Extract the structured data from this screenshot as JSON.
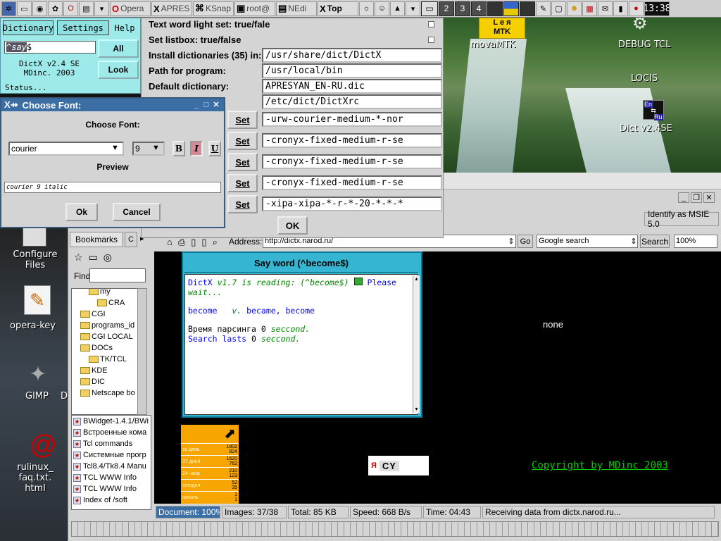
{
  "taskbar": {
    "tasks": [
      "Opera",
      "APRES",
      "KSnap",
      "root@",
      "NEdi",
      "Top"
    ],
    "desktops": [
      "2",
      "3",
      "4"
    ],
    "clock": "13:38"
  },
  "desktop": {
    "icons": {
      "movamtk": "movaMTK",
      "mtk_badge": "MTK",
      "mtk_badge_top": "L e я",
      "debug": "DEBUG TCL",
      "locis": "LOCIS",
      "dict": "Dict v2.4SE",
      "dict_icon_en": "En",
      "dict_icon_ru": "Ru",
      "configure": "Configure\nFiles",
      "opera_key": "opera-key",
      "gimp": "GIMP",
      "gimp_extra": "D",
      "rulinux": "rulinux_\nfaq.txt.\nhtml"
    }
  },
  "dictx": {
    "menu": [
      "Dictionary",
      "Settings",
      "Help"
    ],
    "input": "^say$",
    "input_highlight": "say",
    "input_prefix": "^",
    "input_suffix": "$",
    "all_label": "All",
    "look_label": "Look",
    "version": "DictX v2.4 SE",
    "company": "MDinc. 2003",
    "status": "Status..."
  },
  "settings": {
    "rows": [
      {
        "label": "Text word light set: true/fale"
      },
      {
        "label": "Set listbox: true/false"
      },
      {
        "label": "Install dictionaries (35) in:",
        "value": "/usr/share/dict/DictX"
      },
      {
        "label": "Path for program:",
        "value": "/usr/local/bin"
      },
      {
        "label": "Default dictionary:",
        "value": "APRESYAN_EN-RU.dic"
      },
      {
        "label": "",
        "value": "/etc/dict/DictXrc"
      }
    ],
    "fonts": [
      "-urw-courier-medium-*-nor",
      "-cronyx-fixed-medium-r-se",
      "-cronyx-fixed-medium-r-se",
      "-cronyx-fixed-medium-r-se",
      "-xipa-xipa-*-r-*-20-*-*-*"
    ],
    "set_label": "Set",
    "ok_label": "OK"
  },
  "choose_font": {
    "title": "Choose Font:",
    "heading": "Choose Font:",
    "font": "courier",
    "size": "9",
    "bold": "B",
    "italic": "I",
    "underline": "U",
    "preview_label": "Preview",
    "preview_text": "courier 9 italic",
    "ok": "Ok",
    "cancel": "Cancel"
  },
  "browser": {
    "identify": "Identify as MSIE 5.0",
    "address_label": "Address:",
    "address": "http://dictx.narod.ru/",
    "go": "Go",
    "search_engine": "Google search",
    "search_btn": "Search",
    "zoom": "100%",
    "sidebar_tab": "Bookmarks",
    "find_label": "Find",
    "tree": [
      {
        "label": "my",
        "indent": 2
      },
      {
        "label": "CRA",
        "indent": 3
      },
      {
        "label": "CGI",
        "indent": 1
      },
      {
        "label": "programs_id",
        "indent": 1
      },
      {
        "label": "CGI LOCAL",
        "indent": 1
      },
      {
        "label": "DOCs",
        "indent": 1
      },
      {
        "label": "TK/TCL",
        "indent": 2
      },
      {
        "label": "KDE",
        "indent": 1
      },
      {
        "label": "DIC",
        "indent": 1
      },
      {
        "label": "Netscape bo",
        "indent": 1
      }
    ],
    "bookmarks": [
      "BWidget-1.4.1/BWi",
      "Встроенные кома",
      "Tcl commands",
      "Системные прогр",
      "Tcl8.4/Tk8.4 Manu",
      "TCL WWW Info",
      "TCL WWW Info",
      "Index of /soft"
    ],
    "none_text": "none",
    "copyright": "Copyright by MDinc 2003",
    "counter": {
      "rows": [
        {
          "label": "за день",
          "a": "1802",
          "b": "824"
        },
        {
          "label": "07 дней",
          "a": "1620",
          "b": "762"
        },
        {
          "label": "24 часа",
          "a": "210",
          "b": "123"
        },
        {
          "label": "сегодня",
          "a": "52",
          "b": "35"
        },
        {
          "label": "началь",
          "a": "1",
          "b": "1"
        }
      ]
    },
    "yandex": "Я",
    "cy": "CY",
    "status": {
      "document": "Document: 100%",
      "images": "Images: 37/38",
      "total": "Total: 85 KB",
      "speed": "Speed: 668 B/s",
      "time": "Time: 04:43",
      "message": "Receiving data from dictx.narod.ru..."
    }
  },
  "sayword": {
    "title": "Say word (^become$)",
    "line1_a": "DictX",
    "line1_b": "v1.7",
    "line1_c": "is",
    "line1_d": "reading: (^become$)",
    "line1_e": "Please",
    "line2": "wait...",
    "entry_word": "become",
    "entry_pos": "v.",
    "entry_forms": "became, become",
    "parse_label": "Время парсинга",
    "parse_num": "0",
    "parse_unit": "seccond.",
    "search_label": "Search lasts",
    "search_num": "0",
    "search_unit": "seccond."
  }
}
